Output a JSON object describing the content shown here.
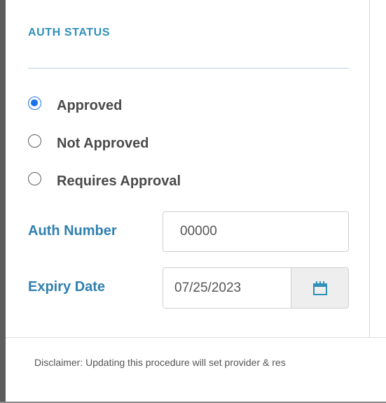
{
  "auth_status": {
    "title": "AUTH STATUS",
    "options": [
      {
        "label": "Approved",
        "checked": true
      },
      {
        "label": "Not Approved",
        "checked": false
      },
      {
        "label": "Requires Approval",
        "checked": false
      }
    ]
  },
  "auth_number": {
    "label": "Auth Number",
    "value": "00000"
  },
  "expiry_date": {
    "label": "Expiry Date",
    "value": "07/25/2023",
    "button_icon": "calendar-icon"
  },
  "footer": {
    "disclaimer": "Disclaimer: Updating this procedure will set provider & res"
  },
  "colors": {
    "accent": "#2f90b9",
    "label": "#2f7fb0",
    "radio_selected": "#1a73e8",
    "text": "#4a4a4a"
  }
}
